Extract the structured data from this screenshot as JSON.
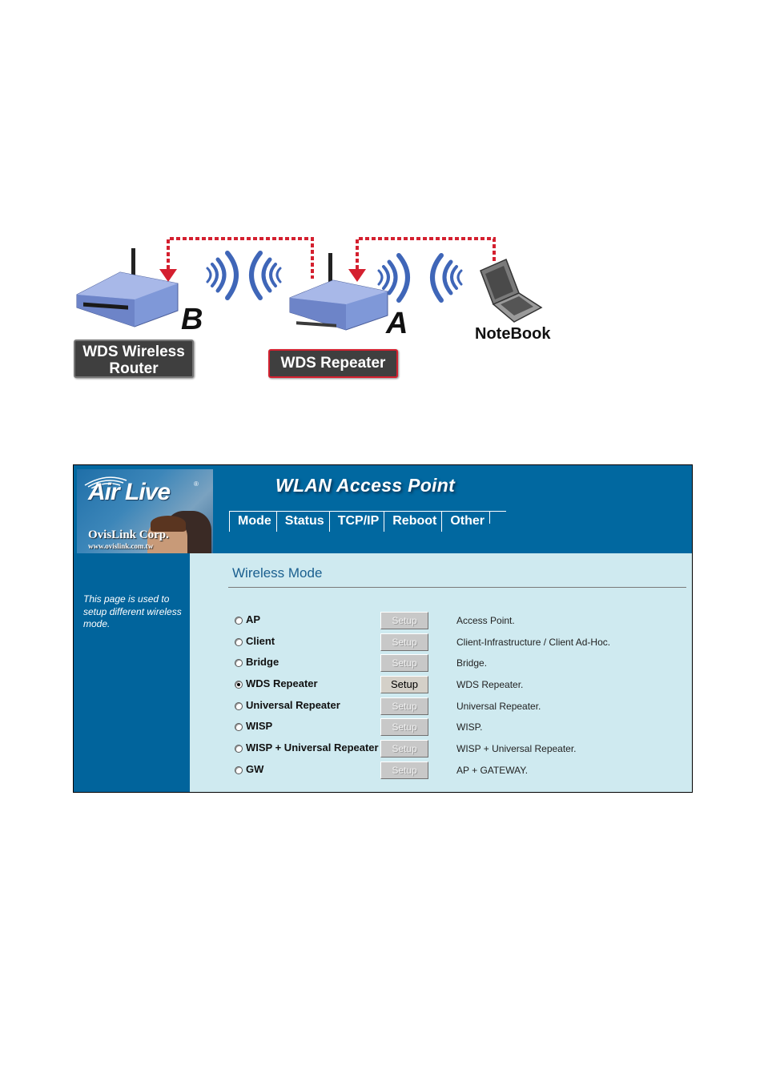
{
  "diagram": {
    "router_label_line1": "WDS Wireless",
    "router_label_line2": "Router",
    "router_letter": "B",
    "repeater_label": "WDS Repeater",
    "repeater_letter": "A",
    "notebook_label": "NoteBook",
    "colors": {
      "dashed_link": "#d4202f",
      "wave": "#3f66b8",
      "device": "#7f98d8",
      "label_bg": "#3f3f3f",
      "repeater_border": "#d4202f"
    }
  },
  "window": {
    "title": "WLAN Access Point",
    "logo": {
      "brand": "Air Live",
      "registered": "®",
      "company": "OvisLink Corp.",
      "url": "www.ovislink.com.tw"
    },
    "nav": [
      {
        "label": "Mode"
      },
      {
        "label": "Status"
      },
      {
        "label": "TCP/IP"
      },
      {
        "label": "Reboot"
      },
      {
        "label": "Other"
      }
    ],
    "sidebar_text": "This page is used to setup different wireless mode.",
    "colors": {
      "header_bg": "#0168a0",
      "sidebar_bg": "#01649c",
      "content_bg": "#cfeaf0",
      "title_text": "#1a5f8f"
    }
  },
  "content": {
    "title": "Wireless Mode",
    "modes": [
      {
        "name": "AP",
        "selected": false,
        "button": "Setup",
        "button_enabled": false,
        "description": "Access Point."
      },
      {
        "name": "Client",
        "selected": false,
        "button": "Setup",
        "button_enabled": false,
        "description": "Client-Infrastructure / Client Ad-Hoc."
      },
      {
        "name": "Bridge",
        "selected": false,
        "button": "Setup",
        "button_enabled": false,
        "description": "Bridge."
      },
      {
        "name": "WDS Repeater",
        "selected": true,
        "button": "Setup",
        "button_enabled": true,
        "description": "WDS Repeater."
      },
      {
        "name": "Universal Repeater",
        "selected": false,
        "button": "Setup",
        "button_enabled": false,
        "description": "Universal Repeater."
      },
      {
        "name": "WISP",
        "selected": false,
        "button": "Setup",
        "button_enabled": false,
        "description": "WISP."
      },
      {
        "name": "WISP + Universal Repeater",
        "selected": false,
        "button": "Setup",
        "button_enabled": false,
        "description": "WISP + Universal Repeater."
      },
      {
        "name": "GW",
        "selected": false,
        "button": "Setup",
        "button_enabled": false,
        "description": "AP + GATEWAY."
      }
    ]
  }
}
